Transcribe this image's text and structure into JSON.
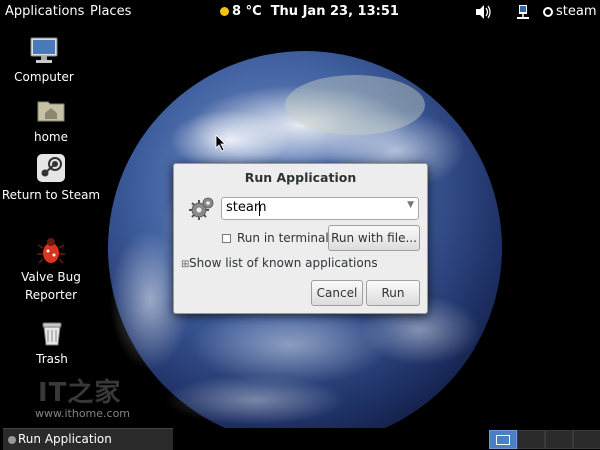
{
  "top_panel": {
    "applications": "Applications",
    "places": "Places",
    "weather": "8 °C",
    "datetime": "Thu Jan 23, 13:51",
    "user": "steam",
    "icons": [
      "weather-sun-icon",
      "volume-icon",
      "network-icon",
      "steam-tray-icon"
    ]
  },
  "desktop": {
    "icons": [
      {
        "label": "Computer",
        "icon": "computer-icon"
      },
      {
        "label": "home",
        "icon": "home-folder-icon"
      },
      {
        "label": "Return to Steam",
        "icon": "steam-icon"
      },
      {
        "label": "Valve Bug Reporter",
        "icon": "bug-icon"
      },
      {
        "label": "Trash",
        "icon": "trash-icon"
      }
    ],
    "watermark": {
      "brand": "IT之家",
      "url": "www.ithome.com"
    }
  },
  "dialog": {
    "title": "Run Application",
    "input_value": "steam",
    "run_in_terminal": "Run in terminal",
    "run_in_terminal_checked": false,
    "run_with_file": "Run with file...",
    "show_list": "Show list of known applications",
    "cancel": "Cancel",
    "run": "Run",
    "icon": "gears-icon"
  },
  "bottom_panel": {
    "task": "Run Application",
    "workspaces": 4,
    "active_workspace": 1
  }
}
